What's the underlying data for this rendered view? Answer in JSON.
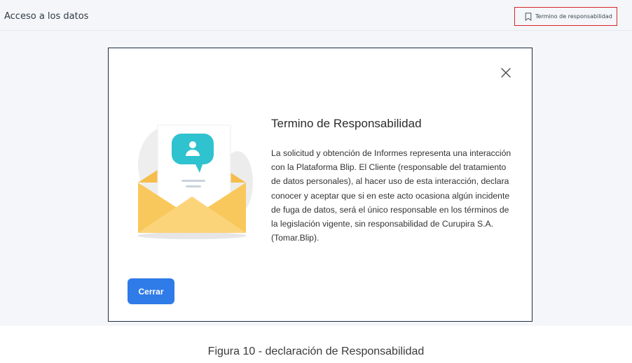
{
  "header": {
    "title": "Acceso a los datos",
    "terms_link": "Termino de responsabilidad",
    "terms_icon": "bookmark-icon"
  },
  "modal": {
    "title": "Termino de Responsabilidad",
    "body": "La solicitud y obtención de Informes representa una interacción con la Plataforma Blip. El Cliente (responsable del tratamiento de datos personales), al hacer uso de esta interacción, declara conocer y aceptar que si en este acto ocasiona algún incidente de fuga de datos, será el único responsable en los términos de la legislación vigente, sin responsabilidad de Curupira S.A. (Tomar.Blip).",
    "close_icon": "close-icon",
    "illustration": "envelope-user-illustration",
    "button_label": "Cerrar"
  },
  "caption": "Figura 10 - declaración de Responsabilidad",
  "colors": {
    "accent": "#2f7be8",
    "highlight": "#d9262b",
    "envelope": "#f9c85c",
    "badge": "#2fc2cf"
  }
}
